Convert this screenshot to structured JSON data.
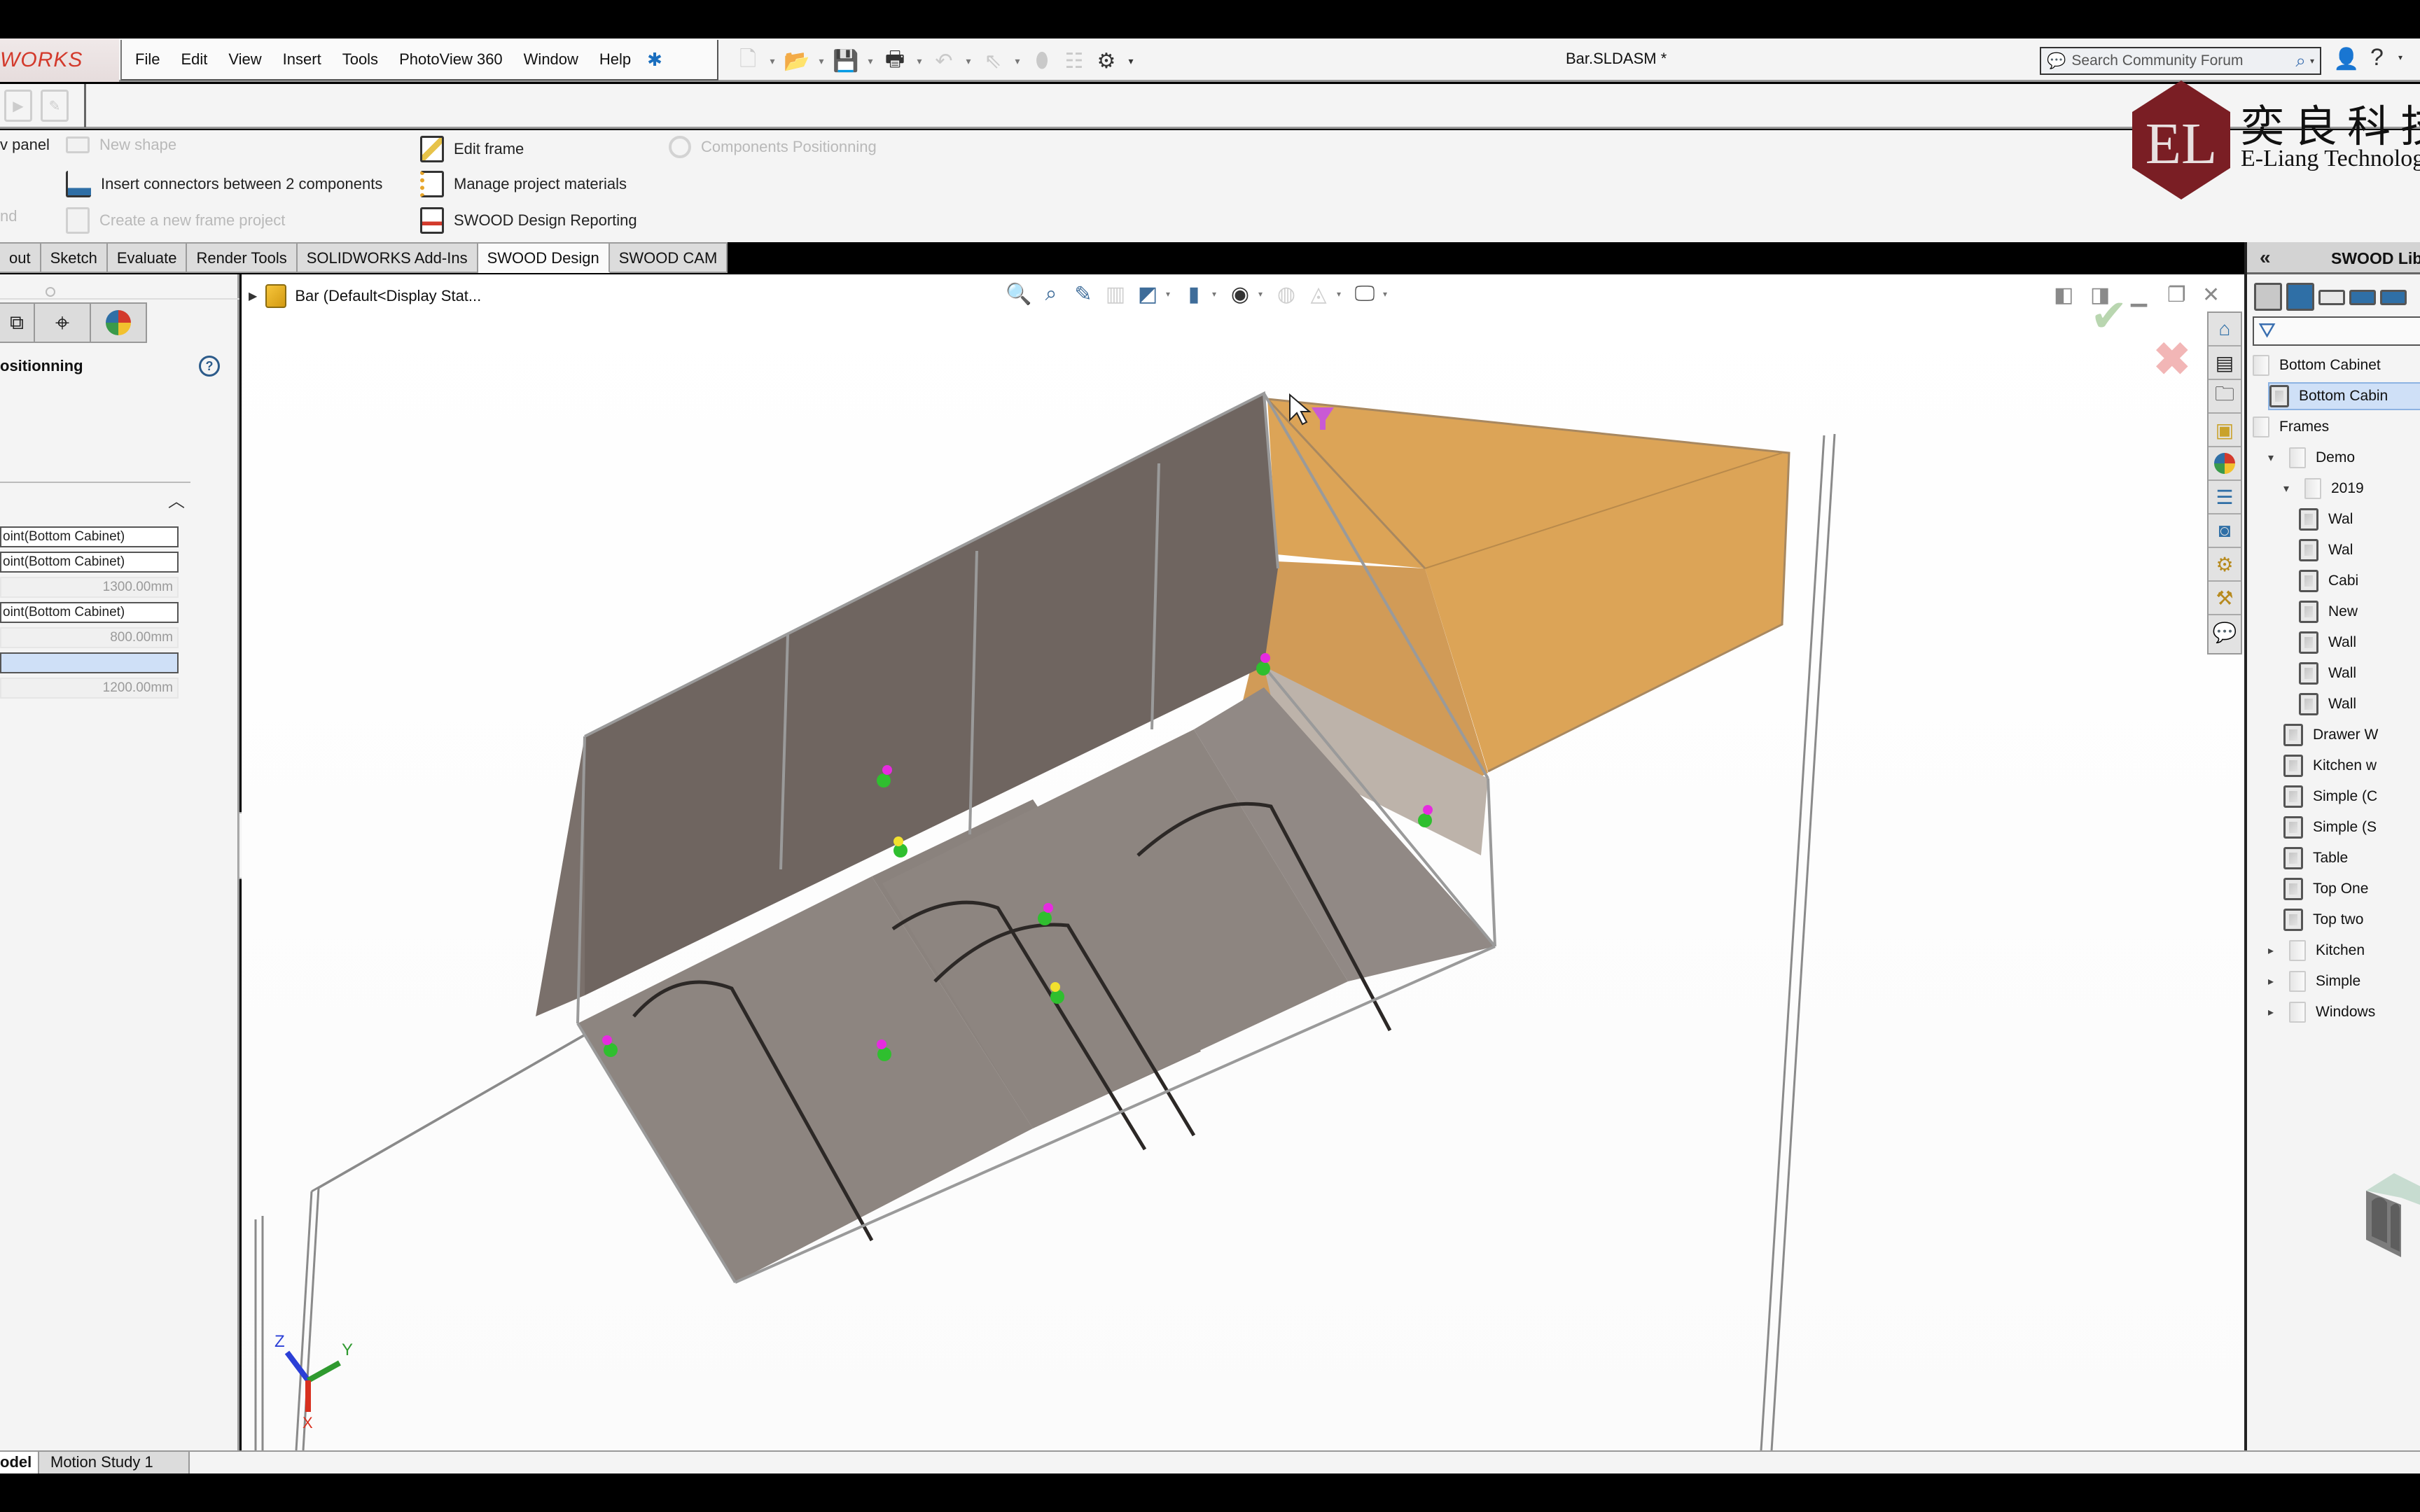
{
  "app": {
    "brand_fragment": "WORKS",
    "document_title": "Bar.SLDASM *"
  },
  "menu": {
    "items": [
      "File",
      "Edit",
      "View",
      "Insert",
      "Tools",
      "PhotoView 360",
      "Window",
      "Help"
    ]
  },
  "search": {
    "placeholder": "Search Community Forum"
  },
  "ribbon": {
    "partial_left_label_1": "v panel",
    "partial_left_label_2": "nd",
    "commands": {
      "new_shape": "New shape",
      "insert_connectors": "Insert connectors between 2 components",
      "create_frame_project": "Create a new frame project",
      "edit_frame": "Edit frame",
      "manage_materials": "Manage project materials",
      "design_reporting": "SWOOD Design Reporting",
      "components_positioning": "Components Positionning"
    }
  },
  "watermark": {
    "monogram": "EL",
    "cn_text": "奕良科技",
    "en_text": "E-Liang Technology",
    "color": "#7a1e24"
  },
  "tabs": [
    {
      "label": "out",
      "active": false
    },
    {
      "label": "Sketch",
      "active": false
    },
    {
      "label": "Evaluate",
      "active": false
    },
    {
      "label": "Render Tools",
      "active": false
    },
    {
      "label": "SOLIDWORKS Add-Ins",
      "active": false
    },
    {
      "label": "SWOOD Design",
      "active": true
    },
    {
      "label": "SWOOD CAM",
      "active": false
    }
  ],
  "property_manager": {
    "title": "ositionning",
    "fields": [
      {
        "type": "text",
        "value": "oint(Bottom Cabinet)"
      },
      {
        "type": "text",
        "value": "oint(Bottom Cabinet)"
      },
      {
        "type": "number",
        "value": "1300.00mm"
      },
      {
        "type": "text",
        "value": "oint(Bottom Cabinet)"
      },
      {
        "type": "number",
        "value": "800.00mm"
      },
      {
        "type": "selection",
        "value": ""
      },
      {
        "type": "number",
        "value": "1200.00mm"
      }
    ]
  },
  "feature_tree": {
    "root_label": "Bar  (Default<Display Stat..."
  },
  "triad": {
    "x_label": "X",
    "y_label": "Y",
    "z_label": "Z"
  },
  "colors": {
    "cabinet_body": "#6f6560",
    "cabinet_front": "#8d8580",
    "preview_box": "#d89a45",
    "selection_blue": "#cfe0f7",
    "accent_red": "#d33a2c"
  },
  "library": {
    "title": "SWOOD Lib",
    "collapse_label": "«",
    "tree": [
      {
        "label": "Bottom Cabinet",
        "kind": "folder",
        "level": 0,
        "expanded": null
      },
      {
        "label": "Bottom Cabin",
        "kind": "item",
        "level": 1,
        "selected": true
      },
      {
        "label": "Frames",
        "kind": "folder",
        "level": 0,
        "expanded": null
      },
      {
        "label": "Demo",
        "kind": "folder",
        "level": 1,
        "expanded": true
      },
      {
        "label": "2019",
        "kind": "folder",
        "level": 2,
        "expanded": true
      },
      {
        "label": "Wal",
        "kind": "item",
        "level": 3
      },
      {
        "label": "Wal",
        "kind": "item",
        "level": 3
      },
      {
        "label": "Cabi",
        "kind": "item",
        "level": 3
      },
      {
        "label": "New",
        "kind": "item",
        "level": 3
      },
      {
        "label": "Wall",
        "kind": "item",
        "level": 3
      },
      {
        "label": "Wall",
        "kind": "item",
        "level": 3
      },
      {
        "label": "Wall",
        "kind": "item",
        "level": 3
      },
      {
        "label": "Drawer W",
        "kind": "item",
        "level": 2
      },
      {
        "label": "Kitchen w",
        "kind": "item",
        "level": 2
      },
      {
        "label": "Simple (C",
        "kind": "item",
        "level": 2
      },
      {
        "label": "Simple (S",
        "kind": "item",
        "level": 2
      },
      {
        "label": "Table",
        "kind": "item",
        "level": 2
      },
      {
        "label": "Top One",
        "kind": "item",
        "level": 2
      },
      {
        "label": "Top two",
        "kind": "item",
        "level": 2
      },
      {
        "label": "Kitchen",
        "kind": "folder",
        "level": 1,
        "expanded": false
      },
      {
        "label": "Simple",
        "kind": "folder",
        "level": 1,
        "expanded": false
      },
      {
        "label": "Windows",
        "kind": "folder",
        "level": 1,
        "expanded": false
      }
    ]
  },
  "bottom_tabs": [
    {
      "label": "odel",
      "active": true
    },
    {
      "label": "Motion Study 1",
      "active": false
    }
  ]
}
